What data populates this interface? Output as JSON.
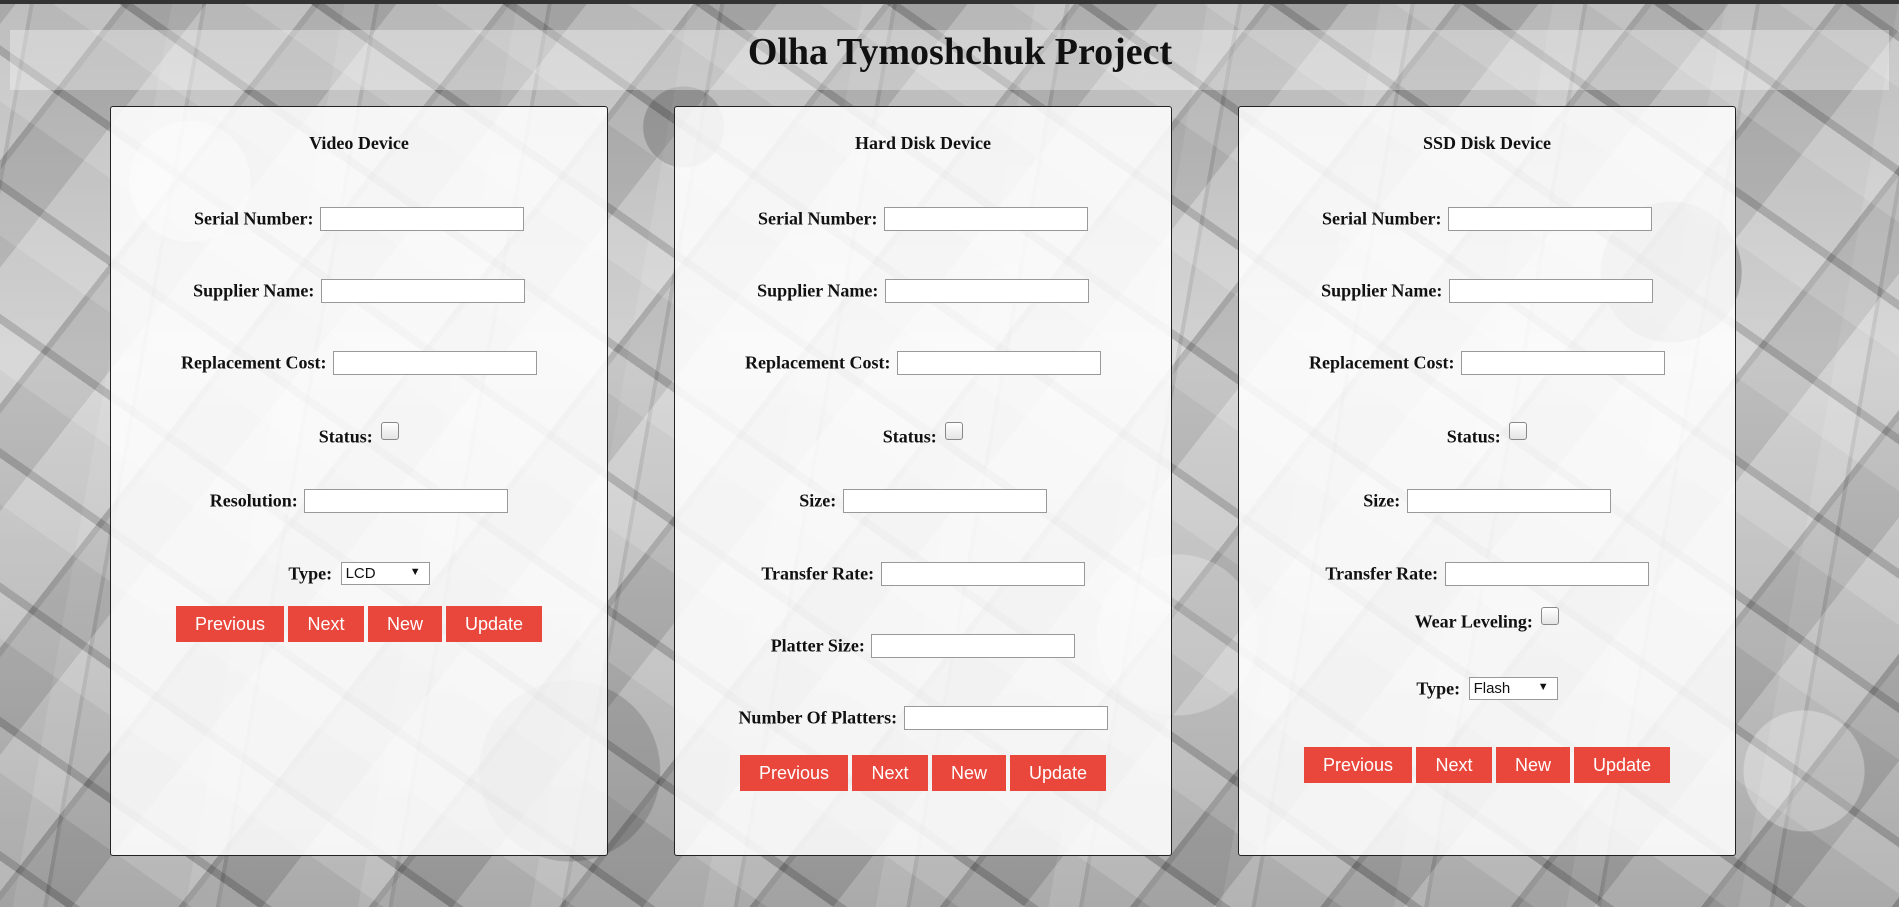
{
  "page_title": "Olha Tymoshchuk Project",
  "buttons": {
    "previous": "Previous",
    "next": "Next",
    "new": "New",
    "update": "Update"
  },
  "video_panel": {
    "title": "Video Device",
    "serial_label": "Serial Number:",
    "supplier_label": "Supplier Name:",
    "cost_label": "Replacement Cost:",
    "status_label": "Status:",
    "resolution_label": "Resolution:",
    "type_label": "Type:",
    "type_value": "LCD"
  },
  "hdd_panel": {
    "title": "Hard Disk Device",
    "serial_label": "Serial Number:",
    "supplier_label": "Supplier Name:",
    "cost_label": "Replacement Cost:",
    "status_label": "Status:",
    "size_label": "Size:",
    "transfer_label": "Transfer Rate:",
    "platter_size_label": "Platter Size:",
    "platters_label": "Number Of Platters:"
  },
  "ssd_panel": {
    "title": "SSD Disk Device",
    "serial_label": "Serial Number:",
    "supplier_label": "Supplier Name:",
    "cost_label": "Replacement Cost:",
    "status_label": "Status:",
    "size_label": "Size:",
    "transfer_label": "Transfer Rate:",
    "wear_label": "Wear Leveling:",
    "type_label": "Type:",
    "type_value": "Flash"
  }
}
